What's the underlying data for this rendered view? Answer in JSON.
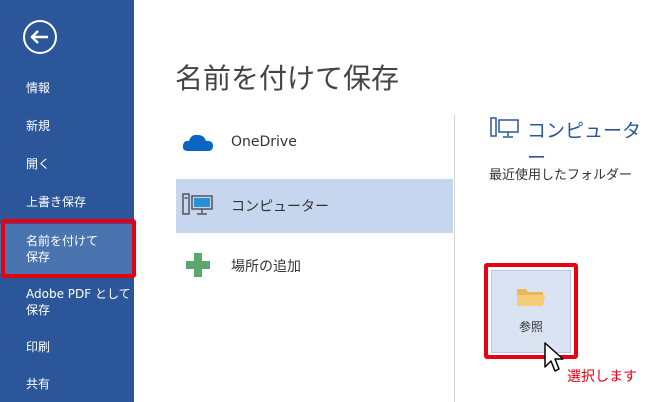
{
  "sidebar": {
    "back_label": "",
    "items": [
      {
        "label": "情報"
      },
      {
        "label": "新規"
      },
      {
        "label": "開く"
      },
      {
        "label": "上書き保存"
      },
      {
        "label": "名前を付けて\n保存"
      },
      {
        "label": "Adobe PDF として\n保存"
      },
      {
        "label": "印刷"
      },
      {
        "label": "共有"
      }
    ]
  },
  "main": {
    "title": "名前を付けて保存",
    "places": [
      {
        "label": "OneDrive",
        "icon": "cloud-icon"
      },
      {
        "label": "コンピューター",
        "icon": "computer-icon"
      },
      {
        "label": "場所の追加",
        "icon": "plus-icon"
      }
    ]
  },
  "right_panel": {
    "header": "コンピューター",
    "recent_folders_label": "最近使用したフォルダー",
    "browse_label": "参照"
  },
  "annotation": {
    "callout": "選択します"
  },
  "colors": {
    "sidebar_bg": "#2b579a",
    "highlight": "#e60012",
    "selected_place": "#c5d6ee"
  }
}
